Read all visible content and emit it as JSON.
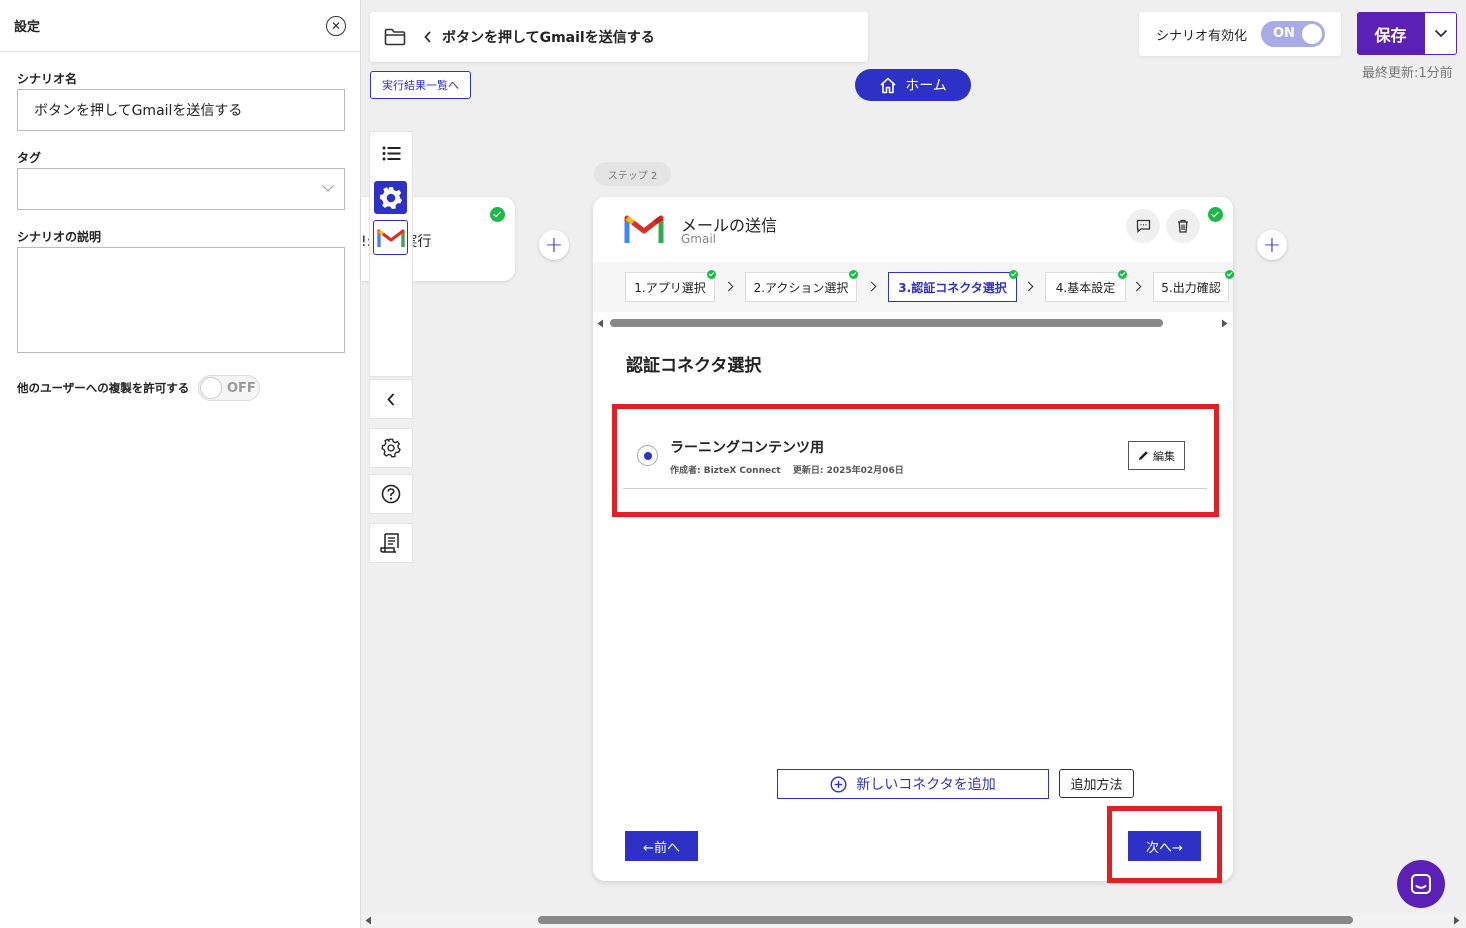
{
  "settings_panel": {
    "title": "設定",
    "scenario_name_label": "シナリオ名",
    "scenario_name_value": "ボタンを押してGmailを送信する",
    "tag_label": "タグ",
    "tag_value": "",
    "description_label": "シナリオの説明",
    "description_value": "",
    "copy_permission_label": "他のユーザーへの複製を許可する",
    "copy_permission_toggle": "OFF"
  },
  "header": {
    "scenario_title": "ボタンを押してGmailを送信する",
    "results_link": "実行結果一覧へ",
    "home_button": "ホーム",
    "enable_label": "シナリオ有効化",
    "enable_toggle": "ON",
    "save_button": "保存",
    "last_updated": "最終更新:1分前"
  },
  "flow": {
    "step1_partial_text": "!: して実行",
    "step_tag": "ステップ 2",
    "step_card": {
      "title": "メールの送信",
      "app": "Gmail",
      "steps": [
        {
          "label": "1.アプリ選択",
          "done": true
        },
        {
          "label": "2.アクション選択",
          "done": true
        },
        {
          "label": "3.認証コネクタ選択",
          "done": true,
          "active": true
        },
        {
          "label": "4.基本設定",
          "done": true
        },
        {
          "label": "5.出力確認",
          "done": true
        }
      ],
      "section_title": "認証コネクタ選択",
      "connector": {
        "name": "ラーニングコンテンツ用",
        "meta": "作成者: BizteX Connect　 更新日: 2025年02月06日",
        "edit_button": "編集"
      },
      "add_connector_button": "新しいコネクタを追加",
      "howto_button": "追加方法",
      "prev_button": "←前へ",
      "next_button": "次へ→"
    }
  },
  "colors": {
    "primary": "#2e31c6",
    "save_purple": "#5b21b6",
    "highlight_red": "#e31e24",
    "success_green": "#1fb84a"
  }
}
